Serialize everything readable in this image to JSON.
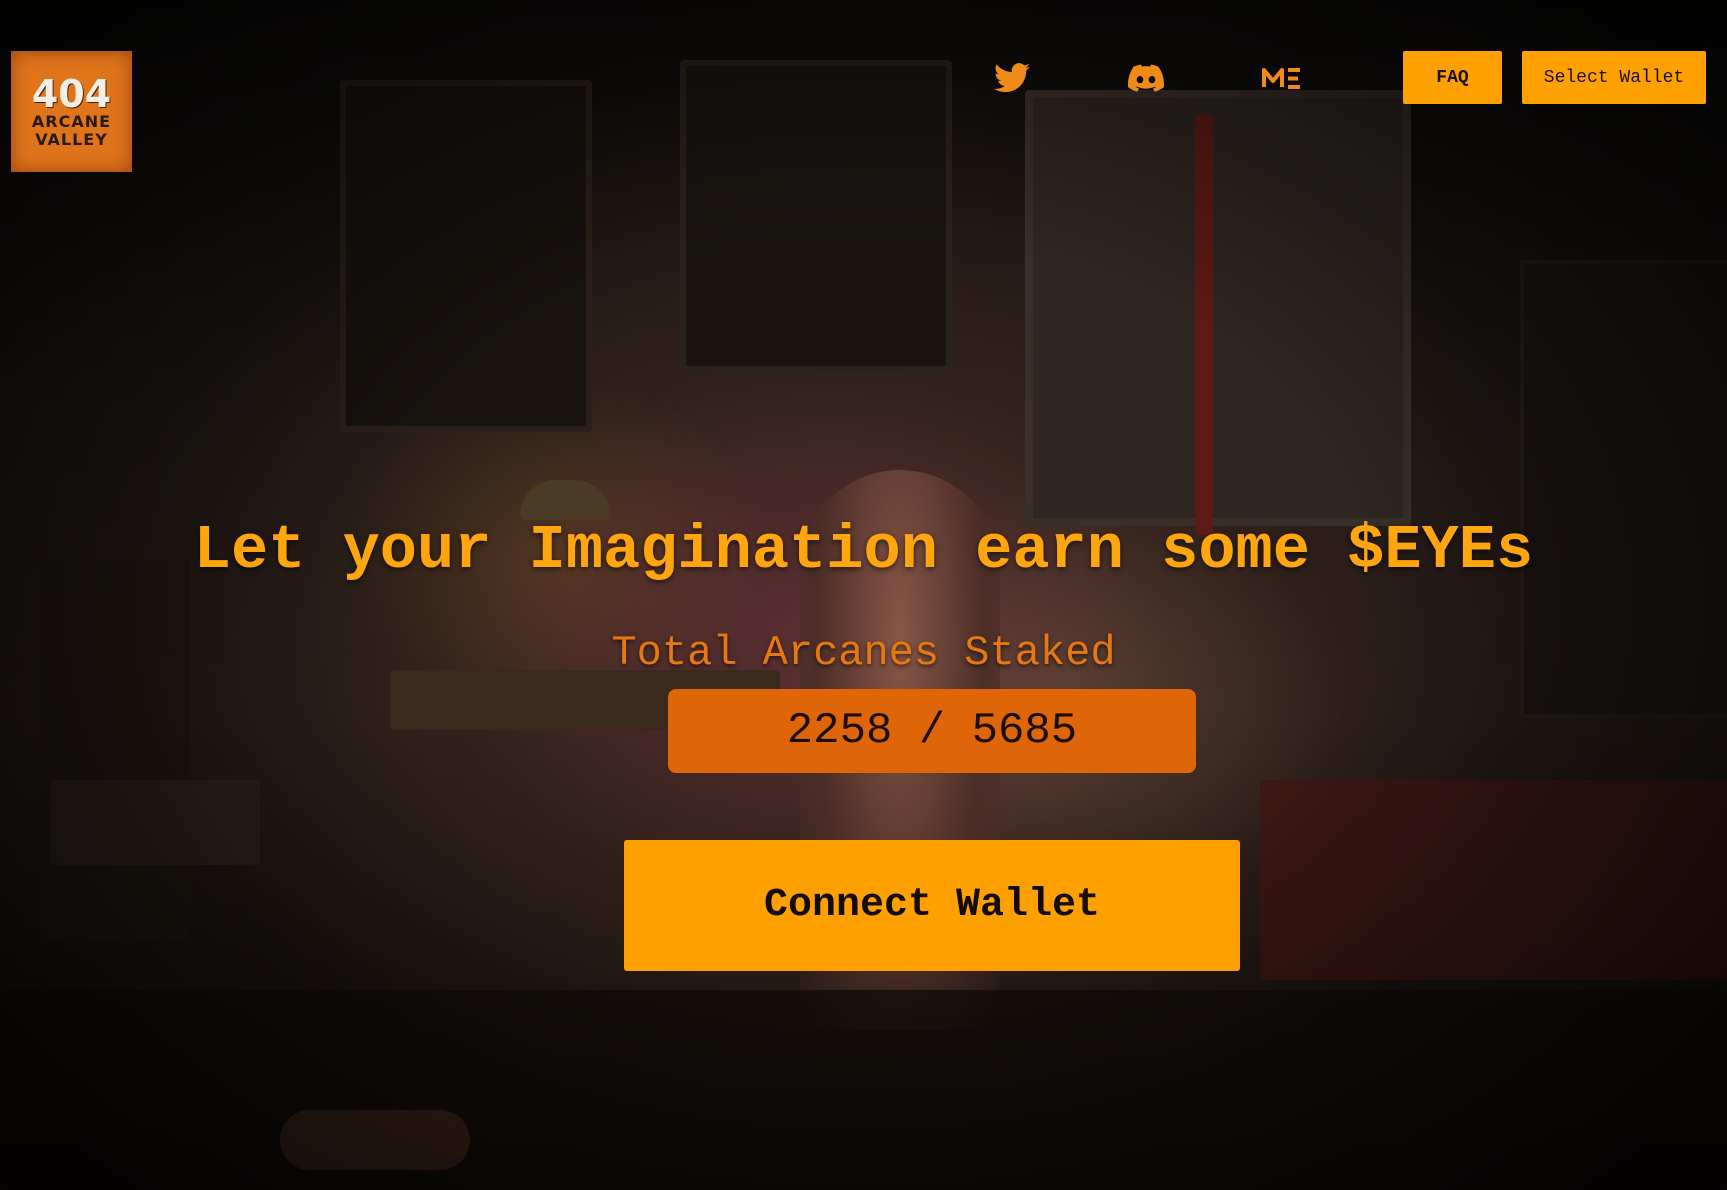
{
  "header": {
    "logo": {
      "number": "404",
      "line1": "ARCANE",
      "line2": "VALLEY"
    },
    "social": {
      "twitter_icon": "twitter-icon",
      "discord_icon": "discord-icon",
      "magiceden_icon": "magic-eden-icon"
    },
    "faq_label": "FAQ",
    "select_wallet_label": "Select Wallet"
  },
  "hero": {
    "headline": "Let your Imagination earn some $EYEs",
    "subheading": "Total Arcanes Staked",
    "staked_count": "2258 / 5685",
    "connect_label": "Connect Wallet"
  },
  "colors": {
    "accent": "#ffa001",
    "counter_bg": "#df6608",
    "headline": "#ffa50e",
    "sub": "#e6780f"
  }
}
